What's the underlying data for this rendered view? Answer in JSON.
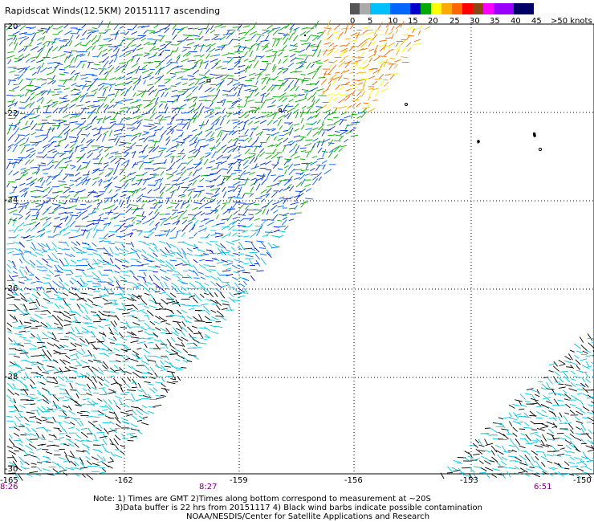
{
  "title": "Rapidscat Winds(12.5KM) 20151117 ascending",
  "legend": {
    "labels": [
      "0",
      "5",
      "10",
      "15",
      "20",
      "25",
      "30",
      "35",
      "40",
      "45",
      ">50 knots"
    ],
    "colors": [
      "#555555",
      "#aaaaaa",
      "#00bfff",
      "#0066ff",
      "#0000cc",
      "#00aa00",
      "#ffff00",
      "#ffaa00",
      "#ff6600",
      "#ff0000",
      "#8b4513",
      "#ff00ff",
      "#9900ff",
      "#000066"
    ]
  },
  "axes": {
    "lat_labels": [
      "-20",
      "-22",
      "-24",
      "-26",
      "-28",
      "-30"
    ],
    "lon_labels": [
      "-165",
      "-162",
      "-159",
      "-156",
      "-153",
      "-150"
    ]
  },
  "times": [
    "8:26",
    "8:27",
    "6:51"
  ],
  "notes": [
    "Note: 1) Times are GMT 2)Times along bottom correspond to measurement at ~20S",
    "3)Data buffer is 22 hrs from 20151117 4) Black wind barbs indicate possible contamination",
    "NOAA/NESDIS/Center for Satellite Applications and Research"
  ],
  "colors": {
    "grid": "#000000",
    "land": "#000000"
  }
}
